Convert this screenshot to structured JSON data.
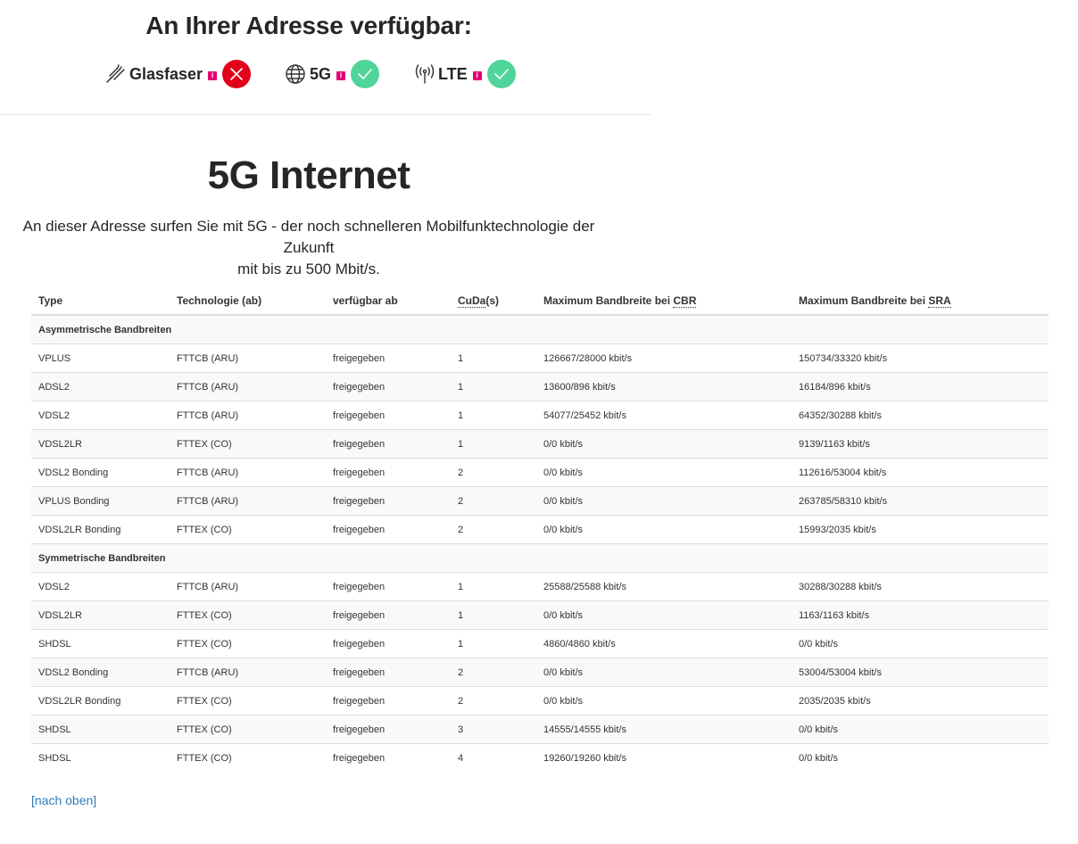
{
  "availability": {
    "title": "An Ihrer Adresse verfügbar:",
    "info_marker": "i",
    "colors": {
      "info": "#e20074",
      "unavailable": "#e2001a",
      "available": "#4fd49a"
    },
    "technologies": [
      {
        "label": "Glasfaser",
        "icon": "fiber-icon",
        "available": false
      },
      {
        "label": "5G",
        "icon": "globe-icon",
        "available": true
      },
      {
        "label": "LTE",
        "icon": "antenna-icon",
        "available": true
      }
    ]
  },
  "section": {
    "title": "5G Internet",
    "subtitle_line1": "An dieser Adresse surfen Sie mit 5G - der noch schnelleren Mobilfunktechnologie der Zukunft",
    "subtitle_line2": "mit bis zu 500 Mbit/s."
  },
  "table": {
    "headers": {
      "type": "Type",
      "technology": "Technologie (ab)",
      "available_from": "verfügbar ab",
      "cuda": "CuDa",
      "cuda_suffix": "(s)",
      "cbr_prefix": "Maximum Bandbreite bei ",
      "cbr_abbr": "CBR",
      "sra_prefix": "Maximum Bandbreite bei ",
      "sra_abbr": "SRA"
    },
    "asym_label": "Asymmetrische Bandbreiten",
    "asym_rows": [
      {
        "type": "VPLUS",
        "tech": "FTTCB (ARU)",
        "from": "freigegeben",
        "cuda": "1",
        "cbr": "126667/28000 kbit/s",
        "sra": "150734/33320 kbit/s"
      },
      {
        "type": "ADSL2",
        "tech": "FTTCB (ARU)",
        "from": "freigegeben",
        "cuda": "1",
        "cbr": "13600/896 kbit/s",
        "sra": "16184/896 kbit/s"
      },
      {
        "type": "VDSL2",
        "tech": "FTTCB (ARU)",
        "from": "freigegeben",
        "cuda": "1",
        "cbr": "54077/25452 kbit/s",
        "sra": "64352/30288 kbit/s"
      },
      {
        "type": "VDSL2LR",
        "tech": "FTTEX (CO)",
        "from": "freigegeben",
        "cuda": "1",
        "cbr": "0/0 kbit/s",
        "sra": "9139/1163 kbit/s"
      },
      {
        "type": "VDSL2 Bonding",
        "tech": "FTTCB (ARU)",
        "from": "freigegeben",
        "cuda": "2",
        "cbr": "0/0 kbit/s",
        "sra": "112616/53004 kbit/s"
      },
      {
        "type": "VPLUS Bonding",
        "tech": "FTTCB (ARU)",
        "from": "freigegeben",
        "cuda": "2",
        "cbr": "0/0 kbit/s",
        "sra": "263785/58310 kbit/s"
      },
      {
        "type": "VDSL2LR Bonding",
        "tech": "FTTEX (CO)",
        "from": "freigegeben",
        "cuda": "2",
        "cbr": "0/0 kbit/s",
        "sra": "15993/2035 kbit/s"
      }
    ],
    "sym_label": "Symmetrische Bandbreiten",
    "sym_rows": [
      {
        "type": "VDSL2",
        "tech": "FTTCB (ARU)",
        "from": "freigegeben",
        "cuda": "1",
        "cbr": "25588/25588 kbit/s",
        "sra": "30288/30288 kbit/s"
      },
      {
        "type": "VDSL2LR",
        "tech": "FTTEX (CO)",
        "from": "freigegeben",
        "cuda": "1",
        "cbr": "0/0 kbit/s",
        "sra": "1163/1163 kbit/s"
      },
      {
        "type": "SHDSL",
        "tech": "FTTEX (CO)",
        "from": "freigegeben",
        "cuda": "1",
        "cbr": "4860/4860 kbit/s",
        "sra": "0/0 kbit/s"
      },
      {
        "type": "VDSL2 Bonding",
        "tech": "FTTCB (ARU)",
        "from": "freigegeben",
        "cuda": "2",
        "cbr": "0/0 kbit/s",
        "sra": "53004/53004 kbit/s"
      },
      {
        "type": "VDSL2LR Bonding",
        "tech": "FTTEX (CO)",
        "from": "freigegeben",
        "cuda": "2",
        "cbr": "0/0 kbit/s",
        "sra": "2035/2035 kbit/s"
      },
      {
        "type": "SHDSL",
        "tech": "FTTEX (CO)",
        "from": "freigegeben",
        "cuda": "3",
        "cbr": "14555/14555 kbit/s",
        "sra": "0/0 kbit/s"
      },
      {
        "type": "SHDSL",
        "tech": "FTTEX (CO)",
        "from": "freigegeben",
        "cuda": "4",
        "cbr": "19260/19260 kbit/s",
        "sra": "0/0 kbit/s"
      }
    ]
  },
  "footer": {
    "back_link": "[nach oben]"
  }
}
